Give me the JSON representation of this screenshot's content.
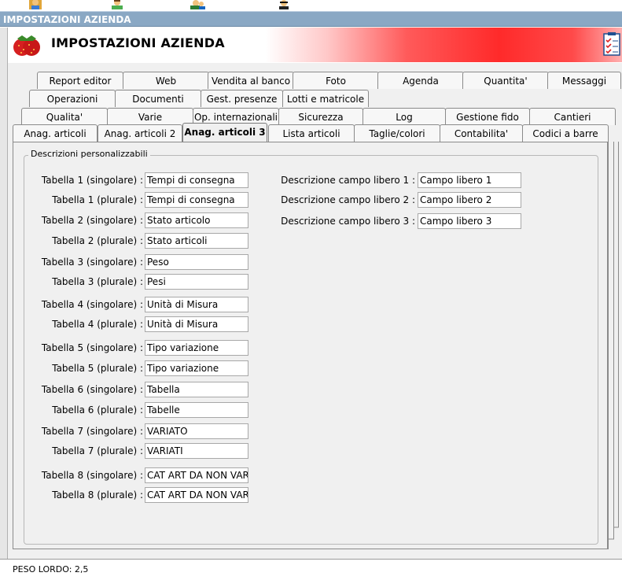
{
  "window": {
    "title": "IMPOSTAZIONI AZIENDA"
  },
  "header": {
    "title": "IMPOSTAZIONI AZIENDA"
  },
  "tabs": {
    "row1": [
      "Report editor",
      "Web",
      "Vendita al banco",
      "Foto",
      "Agenda",
      "Quantita'",
      "Messaggi"
    ],
    "row2": [
      "Operazioni",
      "Documenti",
      "Gest. presenze",
      "Lotti e matricole"
    ],
    "row3": [
      "Qualita'",
      "Varie",
      "Op. internazionali",
      "Sicurezza",
      "Log",
      "Gestione fido",
      "Cantieri"
    ],
    "row4": [
      "Anag. articoli",
      "Anag. articoli 2",
      "Anag. articoli 3",
      "Lista articoli",
      "Taglie/colori",
      "Contabilita'",
      "Codici a barre"
    ]
  },
  "group": {
    "title": "Descrizioni personalizzabili"
  },
  "fields": [
    {
      "label": "Tabella 1 (singolare) :",
      "value": "Tempi di consegna"
    },
    {
      "label": "Tabella 1 (plurale) :",
      "value": "Tempi di consegna"
    },
    {
      "label": "Tabella 2 (singolare) :",
      "value": "Stato articolo"
    },
    {
      "label": "Tabella 2 (plurale) :",
      "value": "Stato articoli"
    },
    {
      "label": "Tabella 3 (singolare) :",
      "value": "Peso"
    },
    {
      "label": "Tabella 3 (plurale) :",
      "value": "Pesi"
    },
    {
      "label": "Tabella 4 (singolare) :",
      "value": "Unità di Misura"
    },
    {
      "label": "Tabella 4 (plurale) :",
      "value": "Unità di Misura"
    },
    {
      "label": "Tabella 5 (singolare) :",
      "value": "Tipo variazione"
    },
    {
      "label": "Tabella 5 (plurale) :",
      "value": "Tipo variazione"
    },
    {
      "label": "Tabella 6 (singolare) :",
      "value": "Tabella"
    },
    {
      "label": "Tabella 6 (plurale) :",
      "value": "Tabelle"
    },
    {
      "label": "Tabella 7 (singolare) :",
      "value": "VARIATO"
    },
    {
      "label": "Tabella 7 (plurale) :",
      "value": "VARIATI"
    },
    {
      "label": "Tabella 8 (singolare) :",
      "value": "CAT ART DA NON VARIA"
    },
    {
      "label": "Tabella 8 (plurale) :",
      "value": "CAT ART DA NON VARIA"
    }
  ],
  "free_fields": [
    {
      "label": "Descrizione campo libero 1 :",
      "value": "Campo libero 1"
    },
    {
      "label": "Descrizione campo libero 2 :",
      "value": "Campo libero 2"
    },
    {
      "label": "Descrizione campo libero 3 :",
      "value": "Campo libero 3"
    }
  ],
  "status": {
    "text": "PESO LORDO: 2,5"
  },
  "icons": {
    "header_left": "strawberry-icon",
    "header_right": "checklist-icon"
  }
}
